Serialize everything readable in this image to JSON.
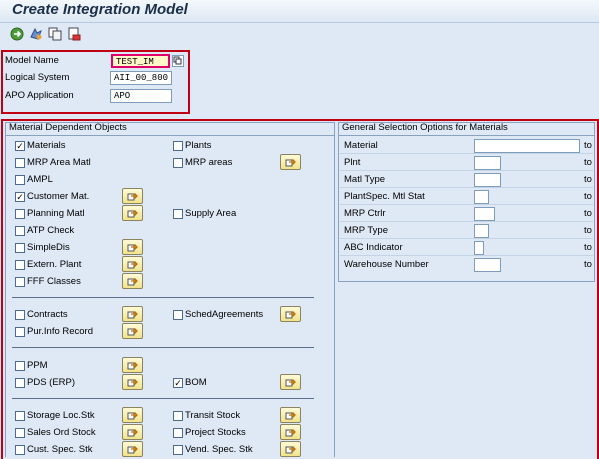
{
  "title": "Create Integration Model",
  "toolbar": {
    "icons": [
      "execute-icon",
      "variant-icon",
      "copy-icon",
      "delete-icon"
    ]
  },
  "header_fields": {
    "model_name_label": "Model Name",
    "model_name_value": "TEST_IM",
    "logical_system_label": "Logical System",
    "logical_system_value": "AII_00_800",
    "apo_application_label": "APO Application",
    "apo_application_value": "APO"
  },
  "material_dependent": {
    "title": "Material Dependent Objects",
    "items": [
      {
        "label": "Materials",
        "checked": true
      },
      {
        "label": "Plants",
        "checked": false
      },
      {
        "label": "MRP Area Matl",
        "checked": false
      },
      {
        "label": "MRP areas",
        "checked": false
      },
      {
        "label": "AMPL",
        "checked": false
      },
      {
        "label": "Customer Mat.",
        "checked": true
      },
      {
        "label": "Planning Matl",
        "checked": false
      },
      {
        "label": "Supply Area",
        "checked": false
      },
      {
        "label": "ATP Check",
        "checked": false
      },
      {
        "label": "SimpleDis",
        "checked": false
      },
      {
        "label": "Extern. Plant",
        "checked": false
      },
      {
        "label": "FFF Classes",
        "checked": false
      },
      {
        "label": "Contracts",
        "checked": false
      },
      {
        "label": "SchedAgreements",
        "checked": false
      },
      {
        "label": "Pur.Info Record",
        "checked": false
      },
      {
        "label": "PPM",
        "checked": false
      },
      {
        "label": "PDS (ERP)",
        "checked": false
      },
      {
        "label": "BOM",
        "checked": true
      },
      {
        "label": "Storage Loc.Stk",
        "checked": false
      },
      {
        "label": "Transit Stock",
        "checked": false
      },
      {
        "label": "Sales Ord Stock",
        "checked": false
      },
      {
        "label": "Project Stocks",
        "checked": false
      },
      {
        "label": "Cust. Spec. Stk",
        "checked": false
      },
      {
        "label": "Vend. Spec. Stk",
        "checked": false
      }
    ]
  },
  "general_selection": {
    "title": "General Selection Options for Materials",
    "to_label": "to",
    "rows": [
      {
        "label": "Material",
        "value": ""
      },
      {
        "label": "Plnt",
        "value": ""
      },
      {
        "label": "Matl Type",
        "value": ""
      },
      {
        "label": "PlantSpec. Mtl Stat",
        "value": ""
      },
      {
        "label": "MRP Ctrlr",
        "value": ""
      },
      {
        "label": "MRP Type",
        "value": ""
      },
      {
        "label": "ABC Indicator",
        "value": ""
      },
      {
        "label": "Warehouse Number",
        "value": ""
      }
    ]
  },
  "colors": {
    "highlight_frame": "#c00012",
    "background": "#dfe9f5",
    "button_yellow": "#f1e38a"
  }
}
